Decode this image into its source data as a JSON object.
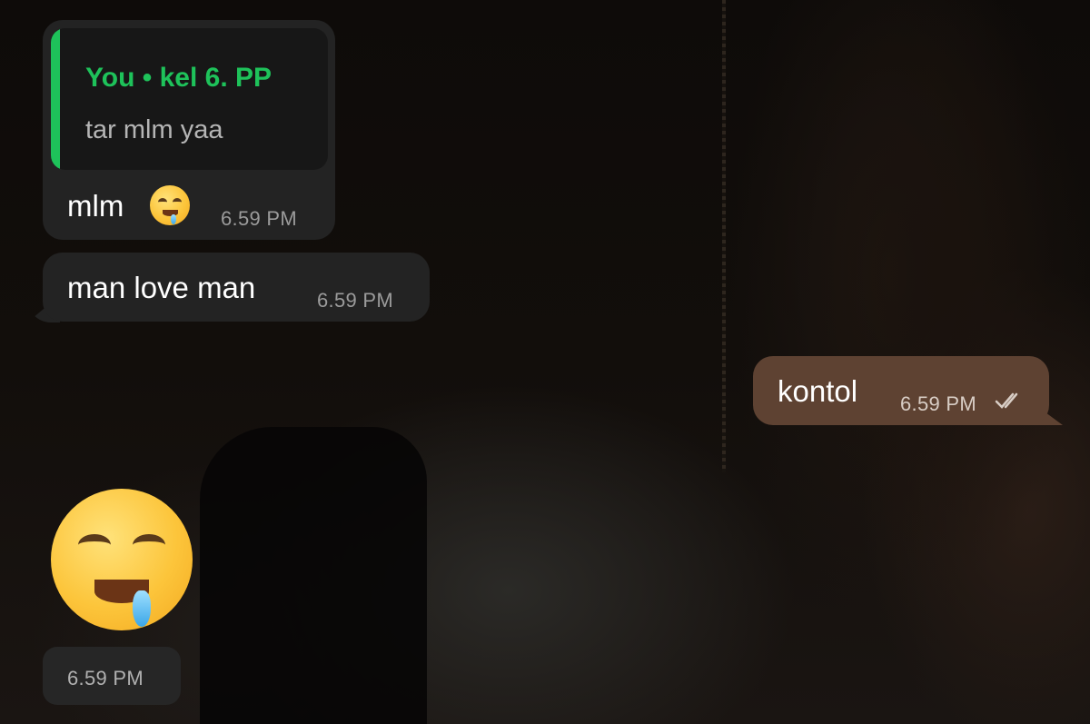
{
  "messages": [
    {
      "direction": "incoming",
      "reply_to": {
        "author": "You • kel 6. PP",
        "text": "tar mlm yaa"
      },
      "text": "mlm",
      "emoji": "drooling-face",
      "time": "6.59 PM"
    },
    {
      "direction": "incoming",
      "text": "man love man",
      "time": "6.59 PM"
    },
    {
      "direction": "outgoing",
      "text": "kontol",
      "time": "6.59 PM",
      "status": "read",
      "status_icon": "double-check-icon"
    },
    {
      "direction": "incoming",
      "sticker": "drooling-face",
      "time": "6.59 PM"
    }
  ],
  "colors": {
    "incoming_bubble": "#232323",
    "outgoing_bubble": "#5e4232",
    "reply_accent": "#1ec25a",
    "time_text": "#9b9b9b"
  }
}
